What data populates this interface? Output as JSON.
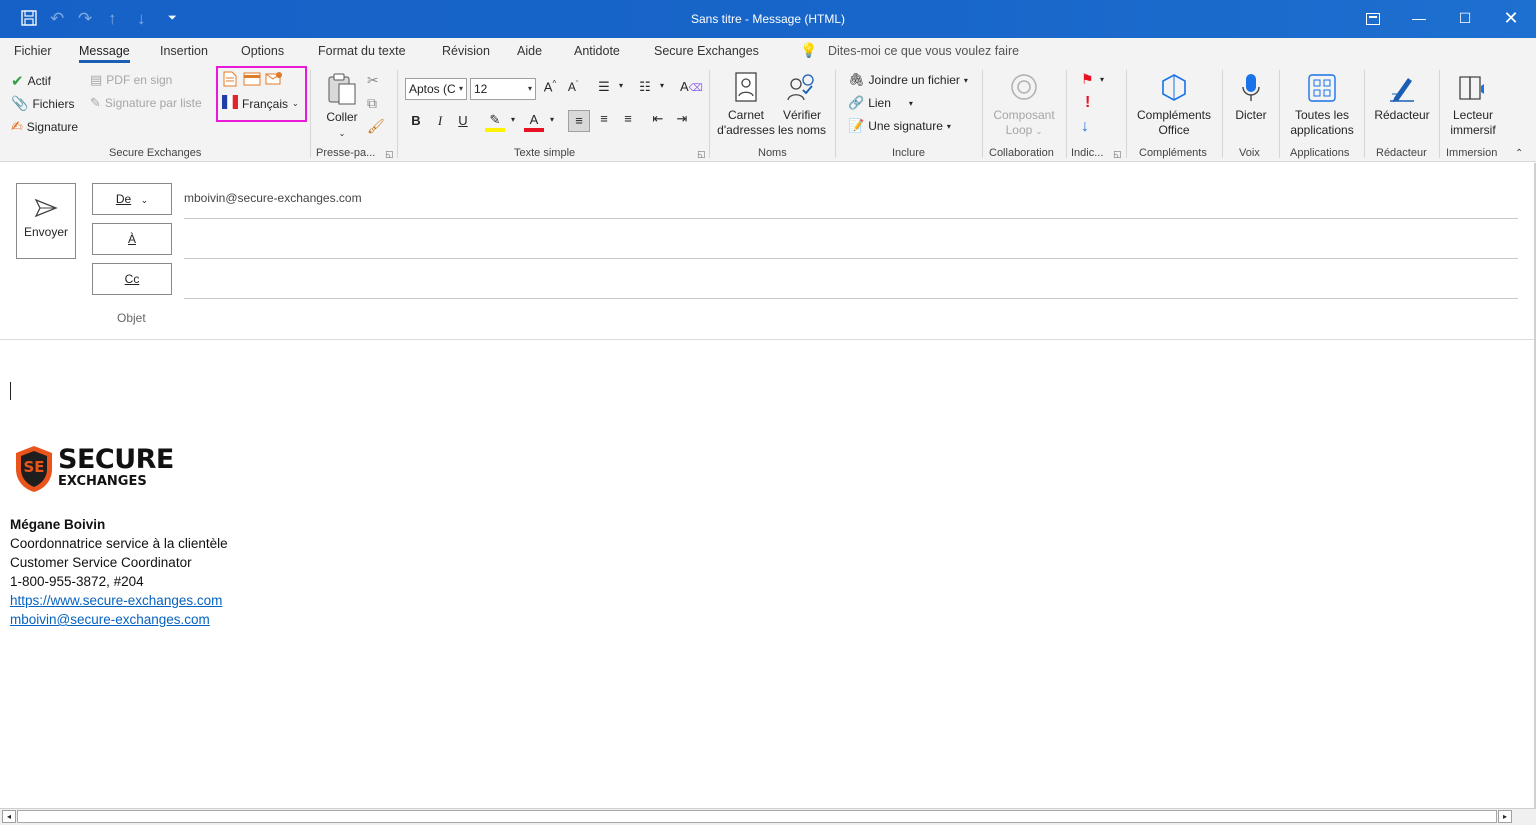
{
  "window": {
    "title": "Sans titre  -  Message (HTML)"
  },
  "tabs": [
    {
      "label": "Fichier"
    },
    {
      "label": "Message"
    },
    {
      "label": "Insertion"
    },
    {
      "label": "Options"
    },
    {
      "label": "Format du texte"
    },
    {
      "label": "Révision"
    },
    {
      "label": "Aide"
    },
    {
      "label": "Antidote"
    },
    {
      "label": "Secure Exchanges"
    }
  ],
  "tell_me": "Dites-moi ce que vous voulez faire",
  "ribbon": {
    "secure_exchanges": {
      "label": "Secure Exchanges",
      "actif": "Actif",
      "fichiers": "Fichiers",
      "signature": "Signature",
      "pdf_en_sign": "PDF en sign",
      "signature_par_liste": "Signature par liste",
      "language": "Français"
    },
    "presse_papiers": {
      "label": "Presse-pa...",
      "coller": "Coller"
    },
    "texte_simple": {
      "label": "Texte simple",
      "font": "Aptos (C",
      "size": "12"
    },
    "noms": {
      "label": "Noms",
      "carnet_line1": "Carnet",
      "carnet_line2": "d'adresses",
      "verifier_line1": "Vérifier",
      "verifier_line2": "les noms"
    },
    "inclure": {
      "label": "Inclure",
      "joindre": "Joindre un fichier",
      "lien": "Lien",
      "signature": "Une signature"
    },
    "collaboration": {
      "label": "Collaboration",
      "line1": "Composant",
      "line2": "Loop"
    },
    "indicateurs": {
      "label": "Indic..."
    },
    "complements": {
      "label": "Compléments",
      "line1": "Compléments",
      "line2": "Office"
    },
    "voix": {
      "label": "Voix",
      "dicter": "Dicter"
    },
    "applications": {
      "label": "Applications",
      "line1": "Toutes les",
      "line2": "applications"
    },
    "redacteur": {
      "label": "Rédacteur",
      "button": "Rédacteur"
    },
    "immersion": {
      "label": "Immersion",
      "line1": "Lecteur",
      "line2": "immersif"
    }
  },
  "compose": {
    "send": "Envoyer",
    "from_btn": "De",
    "from_value": "mboivin@secure-exchanges.com",
    "to_btn": "À",
    "cc_btn": "Cc",
    "subject_label": "Objet"
  },
  "signature": {
    "logo_line1": "SECURE",
    "logo_line2": "EXCHANGES",
    "logo_mark": "SE",
    "name": "Mégane Boivin",
    "title_fr": "Coordonnatrice service à la clientèle",
    "title_en": "Customer Service Coordinator",
    "phone": "1-800-955-3872, #204",
    "website": "https://www.secure-exchanges.com",
    "email": "mboivin@secure-exchanges.com"
  },
  "colors": {
    "titlebar": "#1661c7",
    "accent": "#1a5fb4",
    "highlight_box": "#e81ad8",
    "link": "#0563c1"
  }
}
